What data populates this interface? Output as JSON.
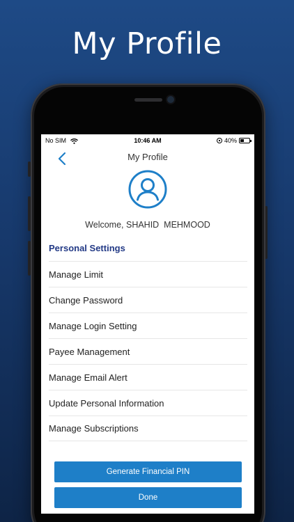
{
  "headline": "My Profile",
  "status_bar": {
    "carrier": "No SIM",
    "time": "10:46 AM",
    "battery_text": "40%",
    "battery_level": 0.4
  },
  "nav": {
    "title": "My Profile",
    "back_icon": "chevron-left-icon"
  },
  "profile": {
    "avatar_icon": "user-circle-icon",
    "welcome": "Welcome, SHAHID  MEHMOOD"
  },
  "settings": {
    "section_title": "Personal Settings",
    "items": [
      {
        "label": "Manage Limit"
      },
      {
        "label": "Change Password"
      },
      {
        "label": "Manage Login Setting"
      },
      {
        "label": "Payee Management"
      },
      {
        "label": "Manage Email Alert"
      },
      {
        "label": "Update Personal Information"
      },
      {
        "label": "Manage Subscriptions"
      }
    ]
  },
  "actions": {
    "generate_pin": "Generate Financial PIN",
    "done": "Done"
  },
  "colors": {
    "accent": "#1e7fc8",
    "section_title": "#233a86",
    "background_top": "#1e4a86",
    "background_bottom": "#0e2446"
  }
}
